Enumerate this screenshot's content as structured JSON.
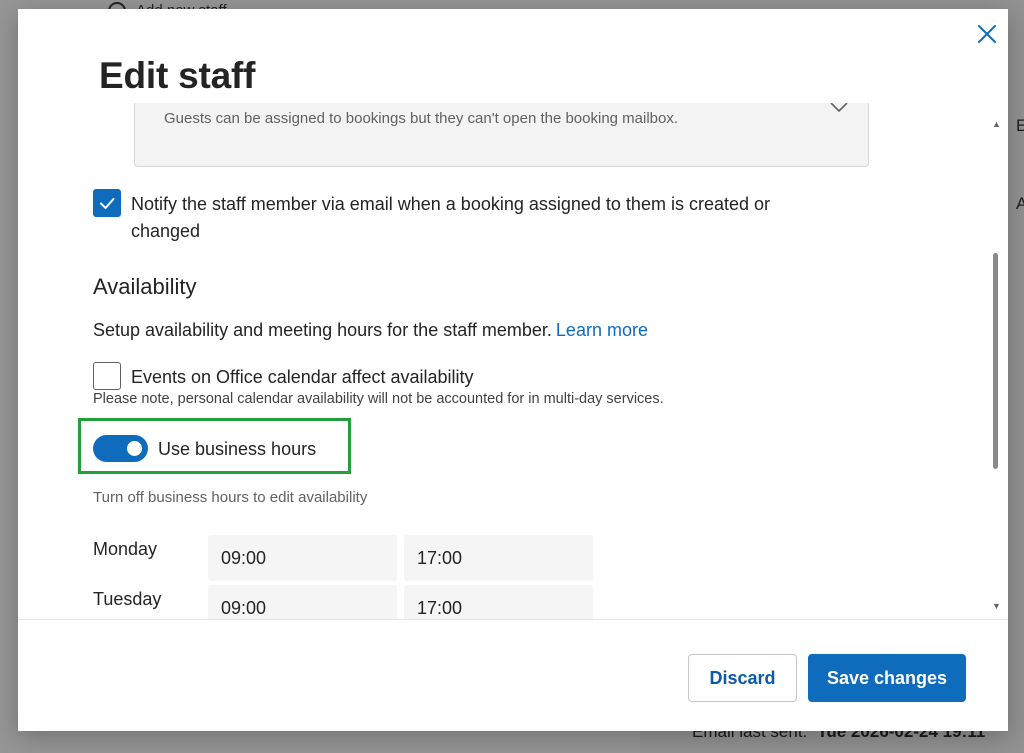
{
  "background": {
    "top_link": "Add new staff",
    "right_letters": [
      "E",
      "A"
    ],
    "bottom_label": "Email last sent:",
    "bottom_value": "Tue 2026-02-24 19:11"
  },
  "dialog": {
    "title": "Edit staff",
    "close_icon": "close-icon",
    "role_description": "Guests can be assigned to bookings but they can't open the booking mailbox.",
    "notify": {
      "checked": true,
      "label": "Notify the staff member via email when a booking assigned to them is created or changed"
    },
    "availability": {
      "heading": "Availability",
      "description": "Setup availability and meeting hours for the staff member.",
      "learn_more": "Learn more",
      "events_checkbox": {
        "checked": false,
        "label": "Events on Office calendar affect availability"
      },
      "note": "Please note, personal calendar availability will not be accounted for in multi-day services.",
      "business_hours_toggle": {
        "on": true,
        "label": "Use business hours"
      },
      "hint": "Turn off business hours to edit availability",
      "days": [
        {
          "day": "Monday",
          "start": "09:00",
          "end": "17:00"
        },
        {
          "day": "Tuesday",
          "start": "09:00",
          "end": "17:00"
        }
      ]
    },
    "footer": {
      "discard_label": "Discard",
      "save_label": "Save changes"
    }
  },
  "colors": {
    "accent": "#0f6cbd",
    "highlight": "#22a03a"
  }
}
